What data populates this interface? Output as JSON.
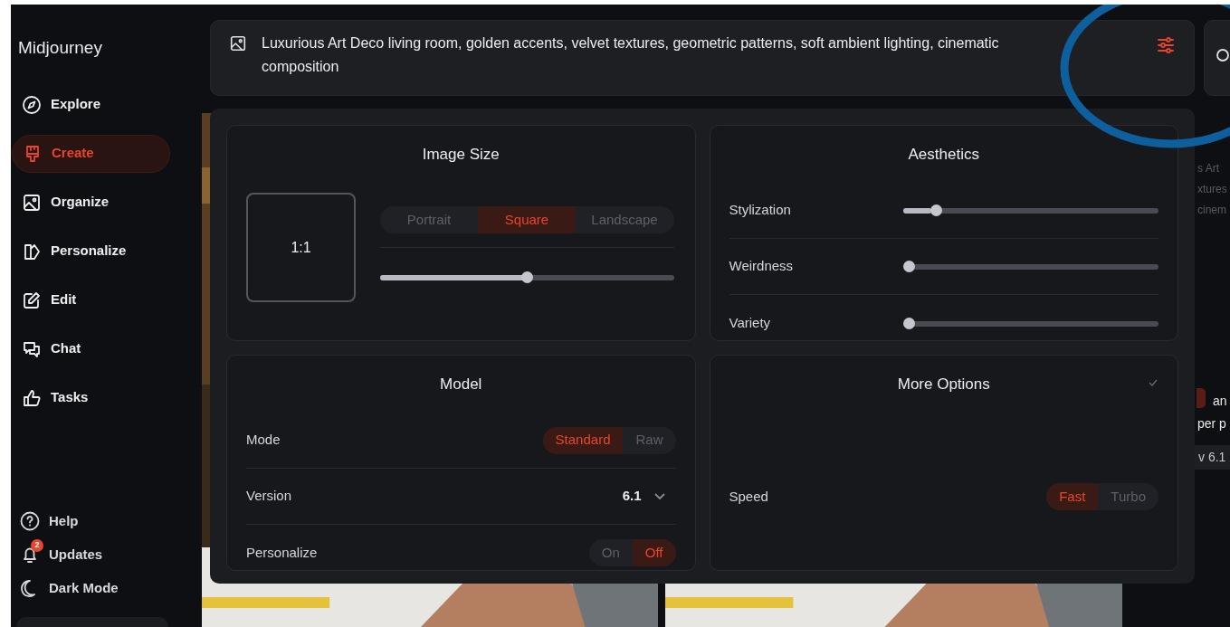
{
  "sidebar": {
    "logo": "Midjourney",
    "items": [
      {
        "label": "Explore",
        "selected": false
      },
      {
        "label": "Create",
        "selected": true
      },
      {
        "label": "Organize",
        "selected": false
      },
      {
        "label": "Personalize",
        "selected": false
      },
      {
        "label": "Edit",
        "selected": false
      },
      {
        "label": "Chat",
        "selected": false
      },
      {
        "label": "Tasks",
        "selected": false
      }
    ],
    "footer_items": [
      {
        "label": "Help"
      },
      {
        "label": "Updates",
        "badge": "2"
      },
      {
        "label": "Dark Mode"
      }
    ]
  },
  "prompt": {
    "text": "Luxurious Art Deco living room, golden accents, velvet textures, geometric patterns, soft ambient lighting, cinematic composition"
  },
  "image_size": {
    "title": "Image Size",
    "ratio": "1:1",
    "orientations": [
      {
        "label": "Portrait",
        "selected": false
      },
      {
        "label": "Square",
        "selected": true
      },
      {
        "label": "Landscape",
        "selected": false
      }
    ],
    "level": 0.5
  },
  "aesthetics": {
    "title": "Aesthetics",
    "sliders": [
      {
        "label": "Stylization",
        "level": 0.11
      },
      {
        "label": "Weirdness",
        "level": 0
      },
      {
        "label": "Variety",
        "level": 0
      }
    ]
  },
  "model": {
    "title": "Model",
    "rows": [
      {
        "kind": "toggle",
        "label": "Mode",
        "options": [
          {
            "label": "Standard",
            "selected": true
          },
          {
            "label": "Raw",
            "selected": false
          }
        ]
      },
      {
        "kind": "select",
        "label": "Version",
        "value": "6.1"
      },
      {
        "kind": "toggle",
        "label": "Personalize",
        "options": [
          {
            "label": "On",
            "selected": false
          },
          {
            "label": "Off",
            "selected": true
          }
        ]
      }
    ]
  },
  "more_options": {
    "title": "More Options",
    "rows": [
      {
        "kind": "toggle",
        "label": "Speed",
        "options": [
          {
            "label": "Fast",
            "selected": true
          },
          {
            "label": "Turbo",
            "selected": false
          }
        ]
      }
    ]
  },
  "background_feed": {
    "faded_lines": [
      "s Art",
      "xtures",
      "cinem"
    ],
    "lines": [
      "an",
      "per p"
    ],
    "version_chip": "v 6.1"
  }
}
